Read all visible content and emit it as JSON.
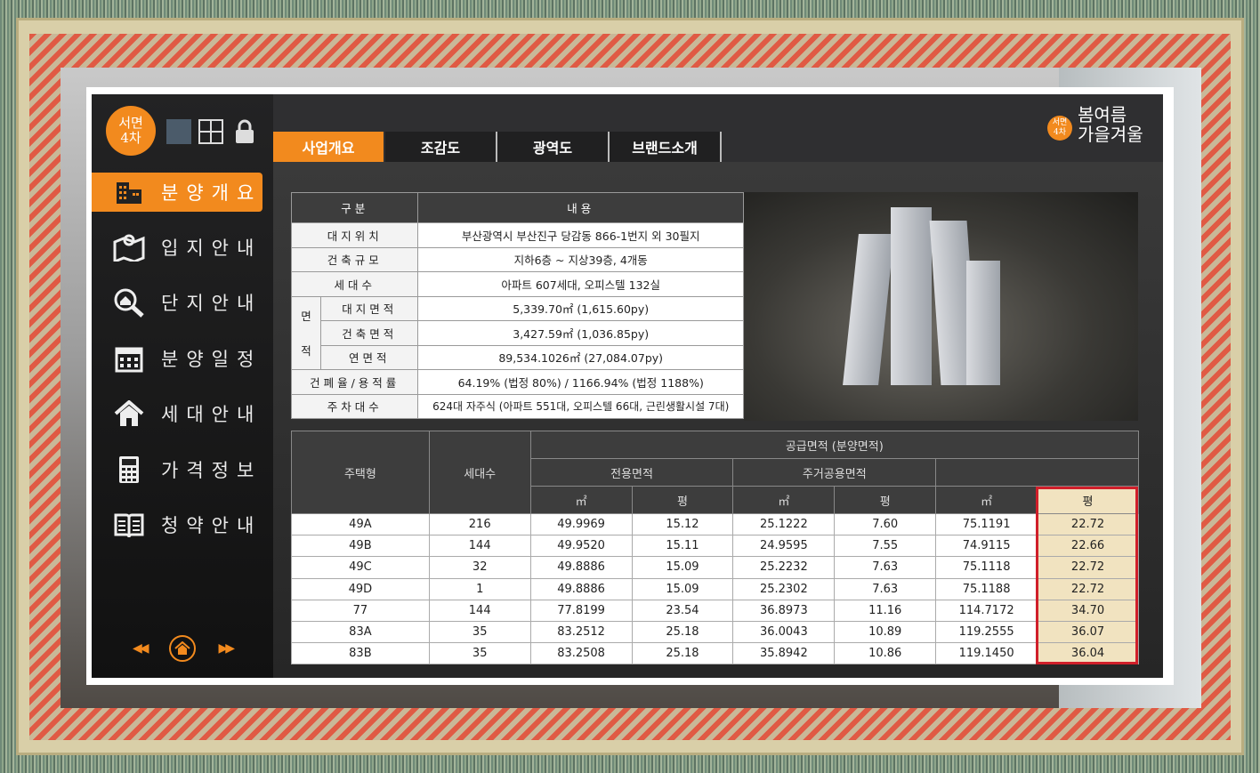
{
  "logo": {
    "line1": "서면",
    "line2": "4차"
  },
  "brand": {
    "badge_line1": "서면",
    "badge_line2": "4차",
    "name_line1": "봄여름",
    "name_line2": "가을겨울"
  },
  "colors": {
    "accent": "#f28a1e",
    "highlight_border": "#d01f2a",
    "highlight_fill": "#f1e3c0",
    "header": "#3d3d3d"
  },
  "toolbar": {
    "icons": [
      "square-icon",
      "grid-icon",
      "lock-icon"
    ]
  },
  "sidebar": {
    "items": [
      {
        "label": "분양개요",
        "icon": "building-icon",
        "active": true
      },
      {
        "label": "입지안내",
        "icon": "map-icon"
      },
      {
        "label": "단지안내",
        "icon": "magnifier-home-icon"
      },
      {
        "label": "분양일정",
        "icon": "calendar-icon"
      },
      {
        "label": "세대안내",
        "icon": "house-icon"
      },
      {
        "label": "가격정보",
        "icon": "calculator-icon"
      },
      {
        "label": "청약안내",
        "icon": "book-icon"
      }
    ],
    "pager": {
      "prev": "◀◀",
      "next": "▶▶"
    }
  },
  "tabs": [
    {
      "label": "사업개요",
      "active": true
    },
    {
      "label": "조감도"
    },
    {
      "label": "광역도"
    },
    {
      "label": "브랜드소개"
    }
  ],
  "info": {
    "header": {
      "k": "구분",
      "v": "내용"
    },
    "location": {
      "k": "대지위치",
      "v": "부산광역시 부산진구 당감동 866-1번지 외 30필지"
    },
    "scale": {
      "k": "건축규모",
      "v": "지하6층 ~ 지상39층, 4개동"
    },
    "units": {
      "k": "세대수",
      "v": "아파트 607세대, 오피스텔 132실"
    },
    "area_side": {
      "line1": "면",
      "line2": "적"
    },
    "site_area": {
      "k": "대지면적",
      "v": "5,339.70㎡ (1,615.60py)"
    },
    "building_area": {
      "k": "건축면적",
      "v": "3,427.59㎡ (1,036.85py)"
    },
    "total_area": {
      "k": "연면적",
      "v": "89,534.1026㎡ (27,084.07py)"
    },
    "ratio": {
      "k": "건폐율/용적률",
      "v": "64.19% (법정 80%) / 1166.94% (법정 1188%)"
    },
    "parking": {
      "k": "주차대수",
      "v": "624대 자주식 (아파트 551대, 오피스텔 66대, 근린생활시설 7대)"
    }
  },
  "area_table": {
    "h_type": "주택형",
    "h_units": "세대수",
    "h_supply": "공급면적 (분양면적)",
    "h_exclusive": "전용면적",
    "h_common": "주거공용면적",
    "u_m2": "㎡",
    "u_py": "평",
    "rows": [
      [
        "49A",
        "216",
        "49.9969",
        "15.12",
        "25.1222",
        "7.60",
        "75.1191",
        "22.72"
      ],
      [
        "49B",
        "144",
        "49.9520",
        "15.11",
        "24.9595",
        "7.55",
        "74.9115",
        "22.66"
      ],
      [
        "49C",
        "32",
        "49.8886",
        "15.09",
        "25.2232",
        "7.63",
        "75.1118",
        "22.72"
      ],
      [
        "49D",
        "1",
        "49.8886",
        "15.09",
        "25.2302",
        "7.63",
        "75.1188",
        "22.72"
      ],
      [
        "77",
        "144",
        "77.8199",
        "23.54",
        "36.8973",
        "11.16",
        "114.7172",
        "34.70"
      ],
      [
        "83A",
        "35",
        "83.2512",
        "25.18",
        "36.0043",
        "10.89",
        "119.2555",
        "36.07"
      ],
      [
        "83B",
        "35",
        "83.2508",
        "25.18",
        "35.8942",
        "10.86",
        "119.1450",
        "36.04"
      ]
    ]
  }
}
